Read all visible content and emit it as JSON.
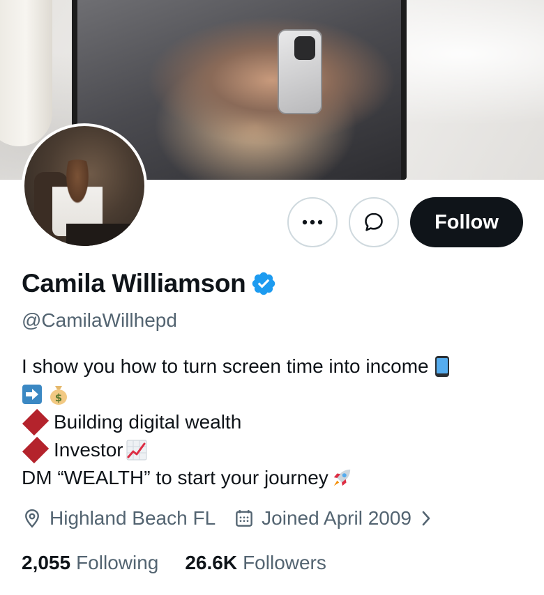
{
  "profile": {
    "name": "Camila Williamson",
    "handle": "@CamilaWillhepd",
    "verified_color": "#1d9bf0"
  },
  "actions": {
    "more_icon": "more-horizontal-icon",
    "message_icon": "message-bubble-icon",
    "follow_label": "Follow"
  },
  "bio": {
    "line1": "I show you how to turn screen time into income",
    "line3": "Building digital wealth",
    "line4": "Investor",
    "line5": "DM “WEALTH” to start your journey"
  },
  "meta": {
    "location": "Highland Beach FL",
    "joined": "Joined April 2009"
  },
  "stats": {
    "following_count": "2,055",
    "following_label": "Following",
    "followers_count": "26.6K",
    "followers_label": "Followers"
  },
  "colors": {
    "text": "#0f1419",
    "secondary": "#536471",
    "follow_bg": "#0f1419",
    "accent": "#1d9bf0",
    "diamond": "#b4232c"
  }
}
